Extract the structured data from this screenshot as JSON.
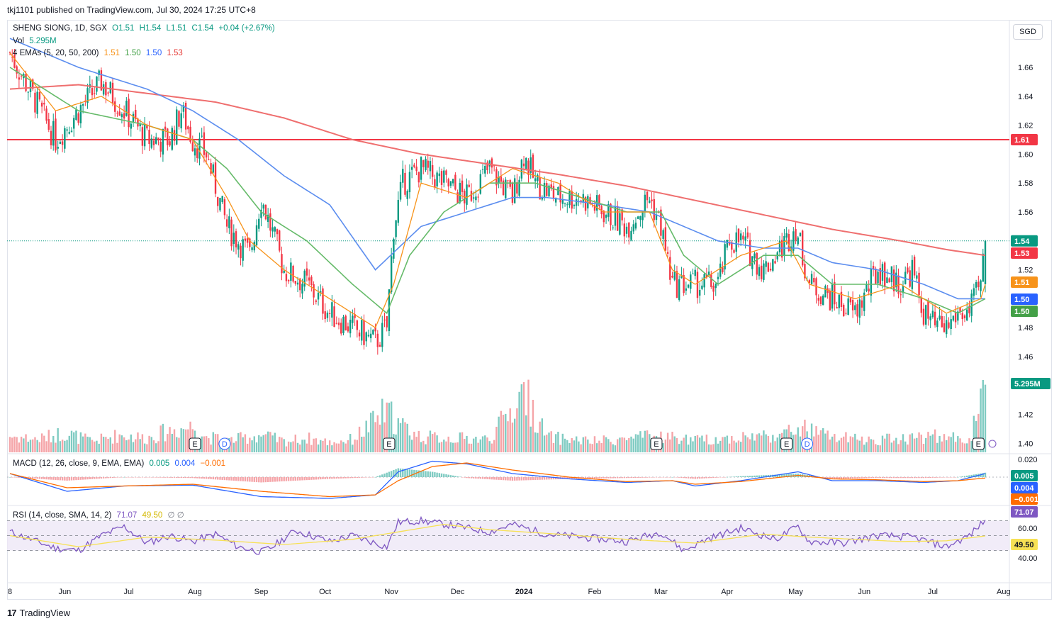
{
  "header": {
    "published": "tkj1101 published on TradingView.com, Jul 30, 2024 17:25 UTC+8"
  },
  "currency_button": "SGD",
  "footer": {
    "brand": "TradingView",
    "logo_icon": "tradingview-logo-icon"
  },
  "legend": {
    "symbol": "SHENG SIONG, 1D, SGX",
    "ohlc": {
      "o": "O1.51",
      "h": "H1.54",
      "l": "L1.51",
      "c": "C1.54",
      "change": "+0.04 (+2.67%)"
    },
    "vol_label": "Vol",
    "vol_value": "5.295M",
    "ema_label": "4 EMAs (5, 20, 50, 200)",
    "ema_values": [
      "1.51",
      "1.50",
      "1.50",
      "1.53"
    ],
    "macd_label": "MACD (12, 26, close, 9, EMA, EMA)",
    "macd_values": [
      "0.005",
      "0.004",
      "−0.001"
    ],
    "rsi_label": "RSI (14, close, SMA, 14, 2)",
    "rsi_values": [
      "71.07",
      "49.50"
    ],
    "rsi_extra": "∅ ∅"
  },
  "colors": {
    "up": "#089981",
    "down": "#f23645",
    "up_vol": "#7fcbc2",
    "down_vol": "#f5a4a8",
    "ema5": "#f7931a",
    "ema20": "#66bb6a",
    "ema50": "#5b8def",
    "ema200": "#ef6f6f",
    "resistance": "#f23645",
    "macd": "#2962ff",
    "signal": "#ff6d00",
    "rsi": "#7e57c2",
    "rsi_ma": "#f7e154",
    "rsi_band": "#ede7f6"
  },
  "chart_data": {
    "type": "candlestick",
    "title": "SHENG SIONG, 1D, SGX",
    "currency": "SGD",
    "price_axis": {
      "ylim": [
        1.38,
        1.68
      ],
      "ticks": [
        "1.66",
        "1.64",
        "1.62",
        "1.60",
        "1.58",
        "1.56",
        "1.52",
        "1.48",
        "1.46",
        "1.42",
        "1.40"
      ]
    },
    "x_labels": [
      "8",
      "Jun",
      "Jul",
      "Aug",
      "Sep",
      "Oct",
      "Nov",
      "Dec",
      "2024",
      "Feb",
      "Mar",
      "Apr",
      "May",
      "Jun",
      "Jul",
      "Aug"
    ],
    "x_label_days": [
      0,
      24,
      52,
      81,
      110,
      138,
      167,
      196,
      225,
      256,
      285,
      314,
      344,
      374,
      404,
      435
    ],
    "last_day": 427,
    "series": [
      {
        "name": "Price",
        "x": [
          0,
          10,
          20,
          30,
          40,
          50,
          60,
          70,
          75,
          80,
          86,
          95,
          105,
          110,
          120,
          130,
          135,
          140,
          150,
          160,
          165,
          168,
          172,
          180,
          190,
          200,
          210,
          220,
          225,
          230,
          240,
          250,
          260,
          270,
          280,
          285,
          290,
          300,
          310,
          315,
          320,
          330,
          340,
          344,
          350,
          360,
          370,
          380,
          390,
          395,
          400,
          405,
          410,
          415,
          420,
          425,
          427
        ],
        "y": [
          1.67,
          1.64,
          1.61,
          1.63,
          1.65,
          1.63,
          1.61,
          1.61,
          1.63,
          1.61,
          1.6,
          1.55,
          1.53,
          1.57,
          1.52,
          1.51,
          1.5,
          1.49,
          1.48,
          1.47,
          1.48,
          1.55,
          1.58,
          1.59,
          1.58,
          1.57,
          1.59,
          1.57,
          1.6,
          1.58,
          1.57,
          1.57,
          1.56,
          1.55,
          1.57,
          1.55,
          1.51,
          1.51,
          1.51,
          1.54,
          1.54,
          1.52,
          1.54,
          1.55,
          1.51,
          1.5,
          1.49,
          1.52,
          1.51,
          1.52,
          1.49,
          1.48,
          1.48,
          1.49,
          1.49,
          1.51,
          1.54
        ]
      },
      {
        "name": "EMA 5",
        "x": [
          0,
          20,
          40,
          60,
          80,
          95,
          105,
          120,
          140,
          160,
          168,
          180,
          200,
          220,
          240,
          260,
          280,
          290,
          300,
          320,
          340,
          350,
          370,
          390,
          410,
          425,
          427
        ],
        "y": [
          1.67,
          1.63,
          1.64,
          1.62,
          1.61,
          1.57,
          1.54,
          1.52,
          1.5,
          1.48,
          1.51,
          1.58,
          1.57,
          1.59,
          1.58,
          1.56,
          1.56,
          1.52,
          1.51,
          1.53,
          1.54,
          1.51,
          1.5,
          1.51,
          1.49,
          1.5,
          1.51
        ]
      },
      {
        "name": "EMA 20",
        "x": [
          0,
          30,
          60,
          80,
          95,
          110,
          130,
          150,
          165,
          175,
          190,
          210,
          230,
          250,
          270,
          285,
          295,
          310,
          330,
          345,
          360,
          380,
          400,
          415,
          427
        ],
        "y": [
          1.66,
          1.63,
          1.62,
          1.61,
          1.59,
          1.56,
          1.54,
          1.51,
          1.49,
          1.53,
          1.56,
          1.58,
          1.58,
          1.57,
          1.56,
          1.56,
          1.53,
          1.51,
          1.53,
          1.53,
          1.51,
          1.51,
          1.5,
          1.49,
          1.5
        ]
      },
      {
        "name": "EMA 50",
        "x": [
          0,
          30,
          60,
          80,
          100,
          120,
          140,
          160,
          170,
          180,
          200,
          220,
          235,
          260,
          280,
          295,
          310,
          330,
          345,
          360,
          380,
          400,
          415,
          427
        ],
        "y": [
          1.68,
          1.66,
          1.645,
          1.63,
          1.61,
          1.585,
          1.565,
          1.52,
          1.535,
          1.55,
          1.56,
          1.57,
          1.57,
          1.565,
          1.56,
          1.55,
          1.54,
          1.535,
          1.535,
          1.525,
          1.52,
          1.51,
          1.5,
          1.5
        ]
      },
      {
        "name": "EMA 200",
        "x": [
          0,
          30,
          60,
          90,
          120,
          150,
          180,
          210,
          240,
          270,
          300,
          330,
          360,
          390,
          410,
          427
        ],
        "y": [
          1.645,
          1.648,
          1.642,
          1.636,
          1.625,
          1.61,
          1.6,
          1.593,
          1.586,
          1.578,
          1.568,
          1.558,
          1.548,
          1.54,
          1.534,
          1.53
        ]
      },
      {
        "name": "Volume",
        "unit": "M",
        "last": 5.295,
        "x": [
          0,
          12,
          24,
          36,
          48,
          60,
          70,
          81,
          86,
          96,
          110,
          120,
          130,
          140,
          150,
          160,
          165,
          170,
          180,
          196,
          210,
          225,
          235,
          255,
          285,
          300,
          315,
          340,
          345,
          360,
          375,
          390,
          404,
          420,
          427
        ],
        "y": [
          1.5,
          1.2,
          1.8,
          1.0,
          1.6,
          1.3,
          2.0,
          2.4,
          1.4,
          1.1,
          1.6,
          1.0,
          1.3,
          0.9,
          1.2,
          2.9,
          3.9,
          2.6,
          1.4,
          1.3,
          1.2,
          5.5,
          1.4,
          1.0,
          1.5,
          1.1,
          1.3,
          1.7,
          2.3,
          1.4,
          1.1,
          1.3,
          1.5,
          1.2,
          5.3
        ]
      },
      {
        "name": "MACD",
        "x": [
          0,
          25,
          50,
          80,
          110,
          140,
          160,
          170,
          185,
          200,
          220,
          245,
          270,
          290,
          300,
          320,
          345,
          360,
          380,
          400,
          415,
          427
        ],
        "y": [
          0.004,
          -0.016,
          -0.01,
          -0.009,
          -0.022,
          -0.024,
          -0.02,
          0.006,
          0.018,
          0.015,
          0.004,
          -0.002,
          -0.006,
          -0.004,
          -0.01,
          -0.004,
          0.006,
          -0.004,
          -0.004,
          -0.006,
          -0.004,
          0.004
        ]
      },
      {
        "name": "MACD signal",
        "x": [
          0,
          25,
          50,
          80,
          110,
          140,
          160,
          170,
          185,
          200,
          220,
          245,
          270,
          290,
          300,
          320,
          345,
          360,
          380,
          400,
          415,
          427
        ],
        "y": [
          0.004,
          -0.012,
          -0.01,
          -0.008,
          -0.016,
          -0.022,
          -0.02,
          -0.004,
          0.012,
          0.016,
          0.008,
          0.0,
          -0.005,
          -0.004,
          -0.008,
          -0.005,
          0.002,
          -0.002,
          -0.003,
          -0.005,
          -0.004,
          -0.001
        ]
      },
      {
        "name": "RSI",
        "x": [
          0,
          20,
          30,
          40,
          50,
          60,
          70,
          80,
          90,
          100,
          110,
          115,
          125,
          140,
          150,
          160,
          165,
          170,
          180,
          195,
          210,
          220,
          235,
          250,
          270,
          285,
          295,
          305,
          320,
          335,
          345,
          350,
          365,
          380,
          395,
          410,
          420,
          427
        ],
        "y": [
          55,
          33,
          30,
          50,
          62,
          40,
          50,
          42,
          52,
          35,
          28,
          35,
          57,
          42,
          50,
          40,
          35,
          68,
          70,
          63,
          55,
          65,
          52,
          48,
          42,
          55,
          30,
          45,
          60,
          45,
          62,
          42,
          40,
          50,
          48,
          35,
          50,
          71
        ]
      },
      {
        "name": "RSI MA",
        "x": [
          0,
          30,
          60,
          90,
          120,
          150,
          170,
          190,
          210,
          240,
          270,
          300,
          330,
          350,
          370,
          390,
          410,
          427
        ],
        "y": [
          50,
          35,
          48,
          44,
          38,
          45,
          55,
          65,
          58,
          52,
          45,
          40,
          52,
          48,
          45,
          42,
          43,
          49.5
        ]
      }
    ],
    "hlines": [
      {
        "name": "resistance",
        "y": 1.61
      }
    ],
    "last_values": {
      "price": "1.54",
      "ema200": "1.53",
      "ema5": "1.51",
      "ema50": "1.50",
      "ema20": "1.50",
      "level": "1.61",
      "volume": "5.295M",
      "macd_ticks": [
        "0.020"
      ],
      "macd": "0.005",
      "signal": "0.004",
      "hist": "−0.001",
      "rsi_ticks": [
        "60.00",
        "40.00"
      ],
      "rsi": "71.07",
      "rsi_ma": "49.50"
    },
    "event_markers": [
      {
        "type": "earnings",
        "label": "E",
        "day": 81
      },
      {
        "type": "dividend",
        "label": "D",
        "day": 94
      },
      {
        "type": "earnings",
        "label": "E",
        "day": 166
      },
      {
        "type": "earnings",
        "label": "E",
        "day": 283
      },
      {
        "type": "earnings",
        "label": "E",
        "day": 340
      },
      {
        "type": "dividend",
        "label": "D",
        "day": 349
      },
      {
        "type": "earnings",
        "label": "E",
        "day": 424
      }
    ]
  }
}
